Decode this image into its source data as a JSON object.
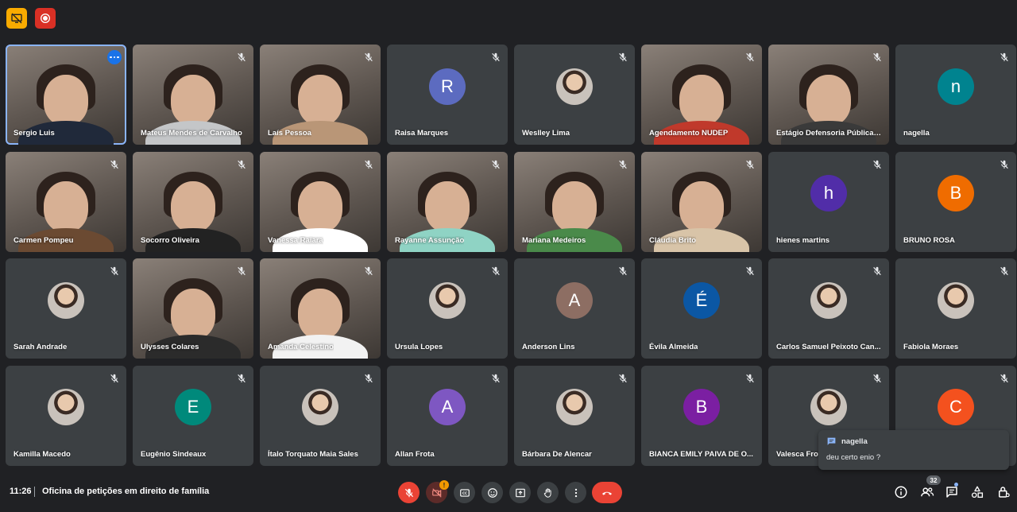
{
  "header": {
    "badges": [
      {
        "icon": "presentation-off-icon",
        "color": "#f9ab00"
      },
      {
        "icon": "recording-icon",
        "color": "#d93025"
      }
    ]
  },
  "participants": [
    {
      "name": "Sergio Luis",
      "type": "video",
      "active": true,
      "menu": true,
      "shirt": "#20293a"
    },
    {
      "name": "Mateus Mendes de Carvalho",
      "type": "video",
      "muted": true,
      "shirt": "#c4c6c8"
    },
    {
      "name": "Laís Pessoa",
      "type": "video",
      "muted": true,
      "shirt": "#b99677"
    },
    {
      "name": "Raisa Marques",
      "type": "initial",
      "initial": "R",
      "color": "#5c6bc0",
      "muted": true
    },
    {
      "name": "Weslley Lima",
      "type": "photo",
      "muted": true
    },
    {
      "name": "Agendamento NUDEP",
      "type": "video",
      "muted": true,
      "shirt": "#c0392b"
    },
    {
      "name": "Estágio Defensoria Pública ...",
      "type": "video",
      "muted": true,
      "shirt": "#3a3a3a"
    },
    {
      "name": "nagella",
      "type": "initial",
      "initial": "n",
      "color": "#00838f",
      "muted": true
    },
    {
      "name": "Carmen Pompeu",
      "type": "video",
      "muted": true,
      "shirt": "#6b4a32"
    },
    {
      "name": "Socorro Oliveira",
      "type": "video",
      "muted": true,
      "shirt": "#222222"
    },
    {
      "name": "Vanessa Raiara",
      "type": "video",
      "muted": true,
      "shirt": "#ffffff"
    },
    {
      "name": "Rayanne Assunção",
      "type": "video",
      "muted": true,
      "shirt": "#8fd3c4"
    },
    {
      "name": "Mariana Medeiros",
      "type": "video",
      "muted": true,
      "shirt": "#4a8a4a"
    },
    {
      "name": "Cláudia Brito",
      "type": "video",
      "muted": true,
      "shirt": "#d8c4a8"
    },
    {
      "name": "hienes martins",
      "type": "initial",
      "initial": "h",
      "color": "#512da8",
      "muted": true
    },
    {
      "name": "BRUNO ROSA",
      "type": "initial",
      "initial": "B",
      "color": "#ef6c00",
      "muted": true
    },
    {
      "name": "Sarah Andrade",
      "type": "photo",
      "muted": true
    },
    {
      "name": "Ulysses Colares",
      "type": "video",
      "muted": true,
      "shirt": "#2b2b2b"
    },
    {
      "name": "Amanda Celestino",
      "type": "video",
      "muted": true,
      "shirt": "#f2f2f2"
    },
    {
      "name": "Ursula Lopes",
      "type": "photo",
      "muted": true
    },
    {
      "name": "Anderson Lins",
      "type": "initial",
      "initial": "A",
      "color": "#8d6e63",
      "muted": true
    },
    {
      "name": "Évila Almeida",
      "type": "initial",
      "initial": "É",
      "color": "#0b57a4",
      "muted": true
    },
    {
      "name": "Carlos Samuel Peixoto Can...",
      "type": "photo",
      "muted": true
    },
    {
      "name": "Fabiola Moraes",
      "type": "photo",
      "muted": true
    },
    {
      "name": "Kamilla Macedo",
      "type": "photo",
      "muted": true
    },
    {
      "name": "Eugênio Sindeaux",
      "type": "initial",
      "initial": "E",
      "color": "#00897b",
      "muted": true
    },
    {
      "name": "Ítalo Torquato Maia Sales",
      "type": "photo",
      "muted": true
    },
    {
      "name": "Allan Frota",
      "type": "initial",
      "initial": "A",
      "color": "#7e57c2",
      "muted": true
    },
    {
      "name": "Bárbara De Alencar",
      "type": "photo",
      "muted": true
    },
    {
      "name": "BIANCA EMILY PAIVA DE O...",
      "type": "initial",
      "initial": "B",
      "color": "#7b1fa2",
      "muted": true
    },
    {
      "name": "Valesca Frota",
      "type": "photo",
      "muted": true
    },
    {
      "name": "",
      "type": "initial",
      "initial": "C",
      "color": "#f4511e",
      "muted": true
    }
  ],
  "bottombar": {
    "time": "11:26",
    "meeting_title": "Oficina de petições em direito de família",
    "camera_warning": "!",
    "people_count": "32"
  },
  "chat_toast": {
    "sender": "nagella",
    "message": "deu certo enio ?"
  }
}
